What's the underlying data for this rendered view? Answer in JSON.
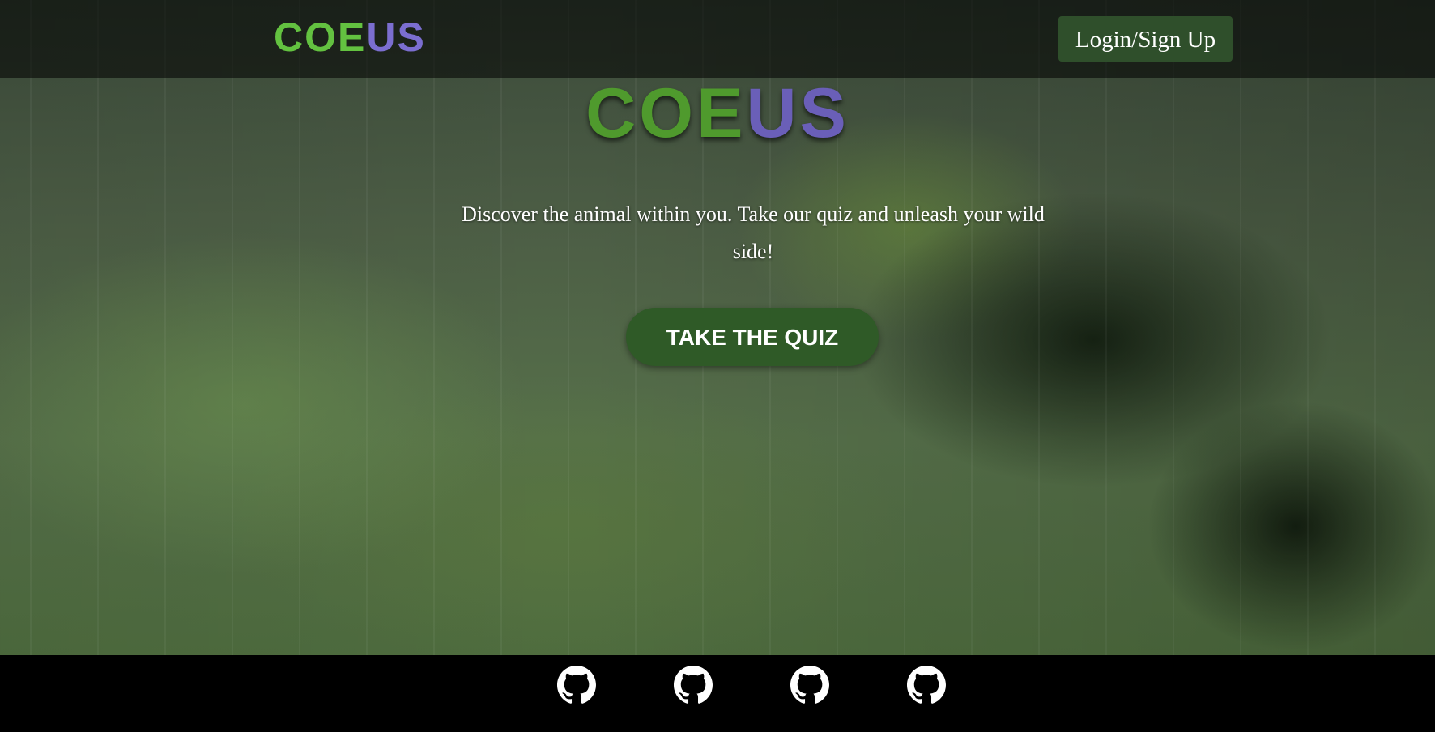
{
  "navbar": {
    "logo_part1": "COE",
    "logo_part2": "US",
    "login_label": "Login/Sign Up"
  },
  "hero": {
    "logo_part1": "COE",
    "logo_part2": "US",
    "tagline": "Discover the animal within you. Take our quiz and unleash your wild side!",
    "quiz_button_label": "TAKE THE QUIZ"
  },
  "footer": {
    "links": [
      {
        "icon": "github-icon"
      },
      {
        "icon": "github-icon"
      },
      {
        "icon": "github-icon"
      },
      {
        "icon": "github-icon"
      }
    ]
  },
  "colors": {
    "logo_green": "#63c240",
    "logo_purple": "#7b6ed0",
    "button_green": "#2f5a27",
    "login_green": "#2f4f2b"
  }
}
